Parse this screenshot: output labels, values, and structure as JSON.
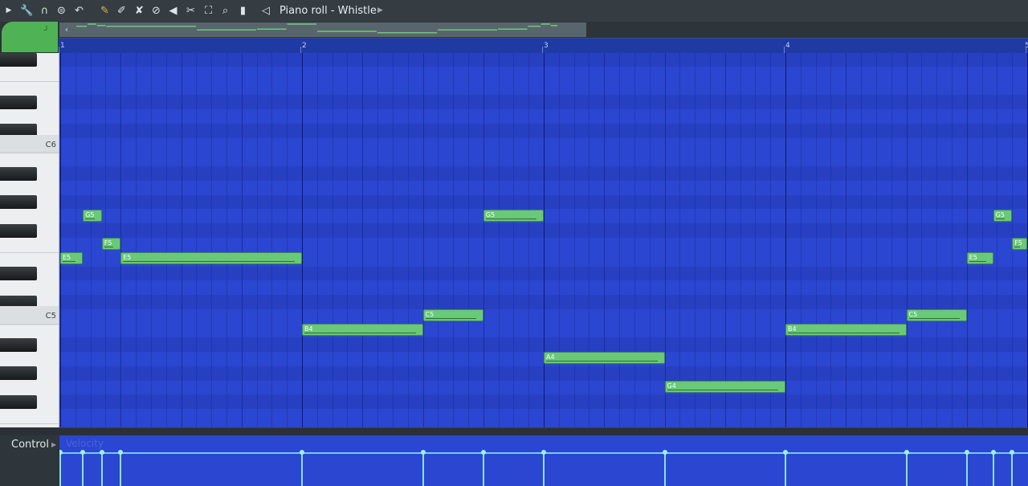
{
  "toolbar": {
    "title": "Piano roll - Whistle",
    "icons": [
      "play-arrow-icon",
      "wrench-icon",
      "magnet-icon",
      "stamp-icon",
      "undo-icon",
      "pencil-icon",
      "paint-icon",
      "delete-icon",
      "mute-icon",
      "speaker-icon",
      "slice-icon",
      "select-icon",
      "zoom-icon",
      "playback-icon",
      "prev-arrow-icon",
      "next-arrow-icon"
    ]
  },
  "ruler": {
    "bars": [
      "1",
      "2",
      "3",
      "4",
      "5"
    ]
  },
  "keyboard": {
    "labels": [
      "C6",
      "C5"
    ]
  },
  "notes": [
    {
      "label": "E5",
      "pitch": "E5",
      "start": 1.0,
      "length": 0.375
    },
    {
      "label": "G5",
      "pitch": "G5",
      "start": 1.375,
      "length": 0.3125
    },
    {
      "label": "F5",
      "pitch": "F5",
      "start": 1.6875,
      "length": 0.3125
    },
    {
      "label": "E5",
      "pitch": "E5",
      "start": 2.0,
      "length": 3.0
    },
    {
      "label": "B4",
      "pitch": "B4",
      "start": 5.0,
      "length": 2.0
    },
    {
      "label": "C5",
      "pitch": "C5",
      "start": 7.0,
      "length": 1.0
    },
    {
      "label": "G5",
      "pitch": "G5",
      "start": 8.0,
      "length": 1.0
    },
    {
      "label": "A4",
      "pitch": "A4",
      "start": 9.0,
      "length": 2.0
    },
    {
      "label": "G4",
      "pitch": "G4",
      "start": 11.0,
      "length": 2.0
    },
    {
      "label": "B4",
      "pitch": "B4",
      "start": 13.0,
      "length": 2.0
    },
    {
      "label": "C5",
      "pitch": "C5",
      "start": 15.0,
      "length": 1.0
    },
    {
      "label": "E5",
      "pitch": "E5",
      "start": 16.0,
      "length": 0.4375
    },
    {
      "label": "G5",
      "pitch": "G5",
      "start": 16.4375,
      "length": 0.3125
    },
    {
      "label": "F5",
      "pitch": "F5",
      "start": 16.75,
      "length": 0.25
    }
  ],
  "control": {
    "label": "Control",
    "parameter": "Velocity"
  },
  "colors": {
    "grid": "#2b46d0",
    "note": "#6ac879",
    "velocity": "#8de0e6"
  }
}
